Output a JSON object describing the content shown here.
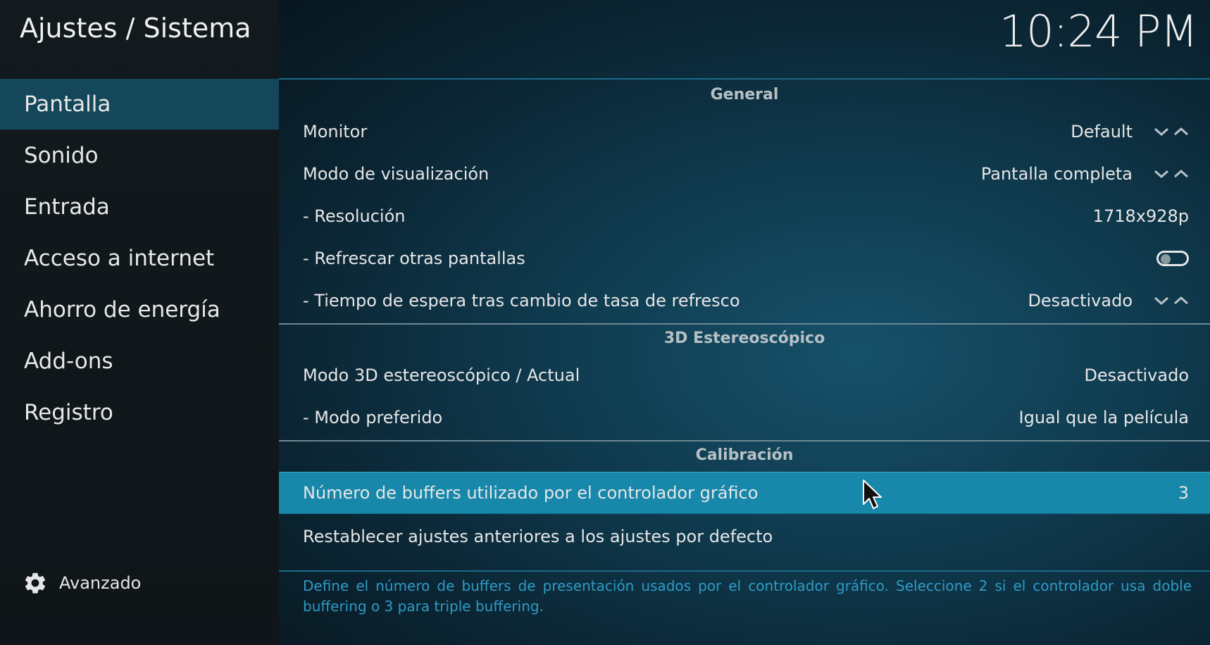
{
  "header": {
    "title": "Ajustes / Sistema",
    "clock": "10:24 PM"
  },
  "sidebar": {
    "items": [
      {
        "label": "Pantalla",
        "active": true
      },
      {
        "label": "Sonido"
      },
      {
        "label": "Entrada"
      },
      {
        "label": "Acceso a internet"
      },
      {
        "label": "Ahorro de energía"
      },
      {
        "label": "Add-ons"
      },
      {
        "label": "Registro"
      }
    ],
    "advanced_label": "Avanzado",
    "advanced_icon": "gear-icon"
  },
  "sections": {
    "general": {
      "title": "General",
      "rows": [
        {
          "label": "Monitor",
          "value": "Default",
          "control": "spinner"
        },
        {
          "label": "Modo de visualización",
          "value": "Pantalla completa",
          "control": "spinner"
        },
        {
          "label": "- Resolución",
          "value": "1718x928p"
        },
        {
          "label": "- Refrescar otras pantallas",
          "control": "toggle",
          "toggle_state": "off"
        },
        {
          "label": "- Tiempo de espera tras cambio de tasa de refresco",
          "value": "Desactivado",
          "control": "spinner"
        }
      ]
    },
    "stereo": {
      "title": "3D Estereoscópico",
      "rows": [
        {
          "label": "Modo 3D estereoscópico / Actual",
          "value": "Desactivado"
        },
        {
          "label": "- Modo preferido",
          "value": "Igual que la película"
        }
      ]
    },
    "calibration": {
      "title": "Calibración",
      "rows": [
        {
          "label": "Número de buffers utilizado por el controlador gráfico",
          "value": "3",
          "focused": true
        },
        {
          "label": "Restablecer ajustes anteriores a los ajustes por defecto"
        }
      ]
    }
  },
  "help_text": "Define el número de buffers de presentación usados por el controlador gráfico. Seleccione 2 si el controlador usa doble buffering o 3 para triple buffering.",
  "colors": {
    "focus": "#1787aa",
    "sidebar_active": "#15475a",
    "help_text": "#2e9bc6"
  }
}
